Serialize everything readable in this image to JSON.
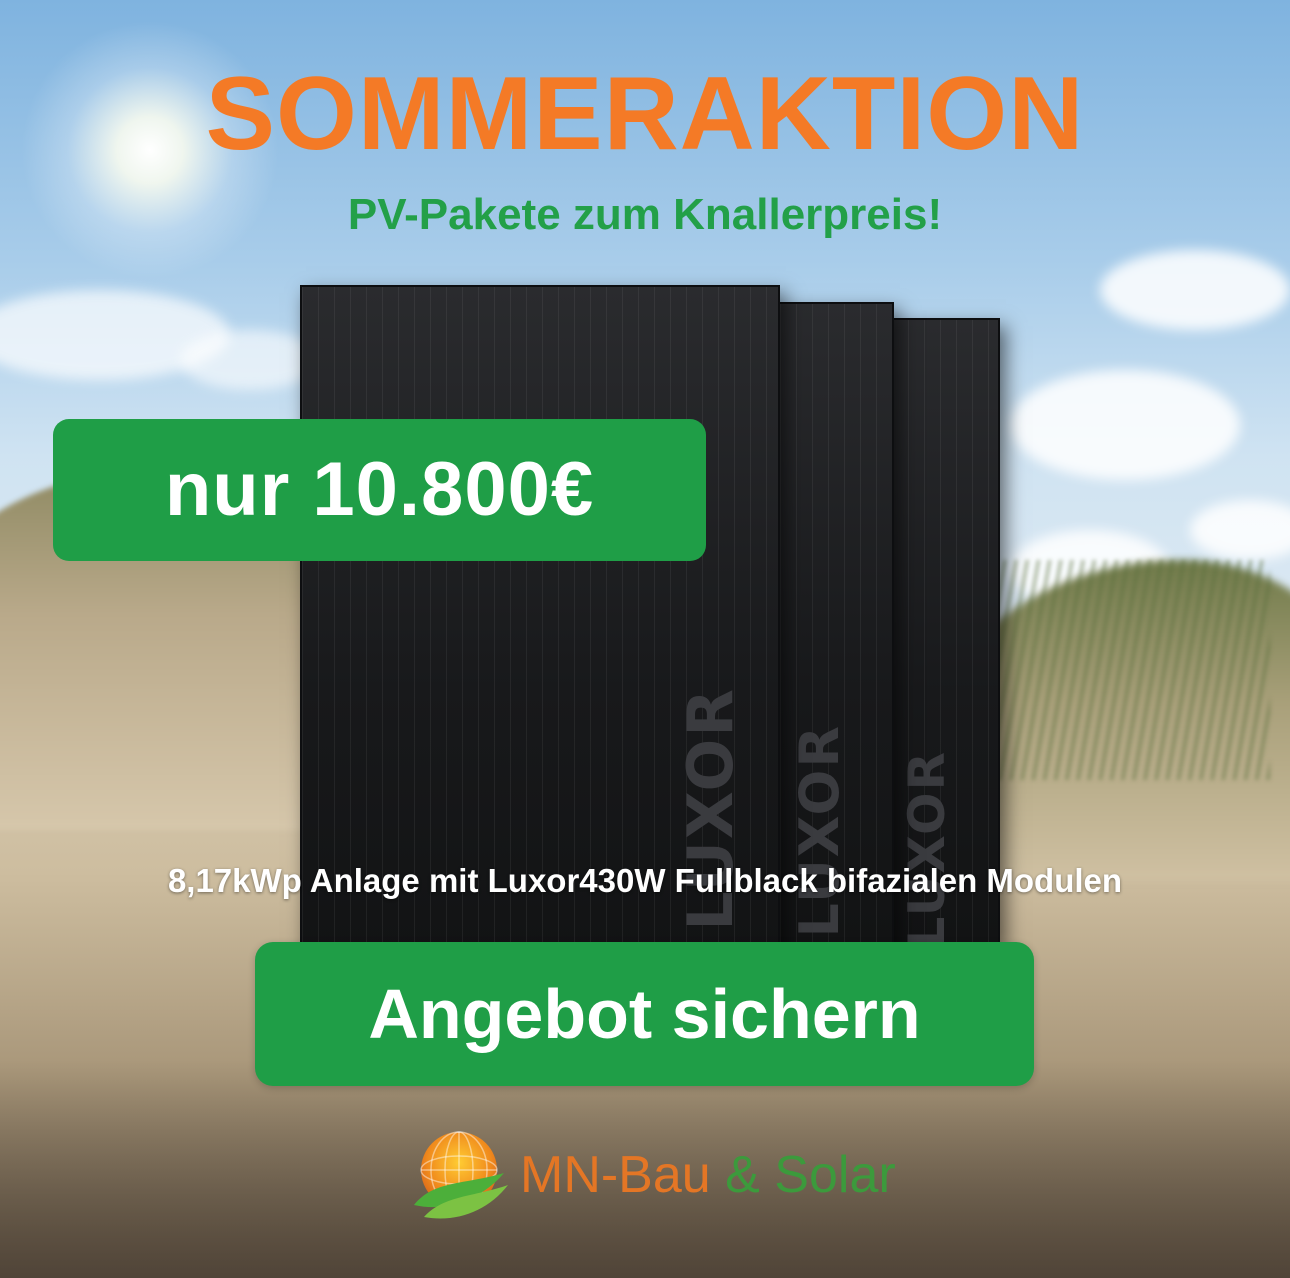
{
  "headline": "SOMMERAKTION",
  "subheadline": "PV-Pakete zum Knallerpreis!",
  "price_badge": "nur 10.800€",
  "description": "8,17kWp Anlage mit Luxor430W Fullblack bifazialen Modulen",
  "cta_label": "Angebot sichern",
  "panel_brand": "LUXOR",
  "logo": {
    "part1": "MN-Bau",
    "part2": "& Solar",
    "icon": "globe-sun-leaf-icon"
  },
  "colors": {
    "headline": "#f47a26",
    "subheadline": "#23a048",
    "badge_bg": "#1f9e47",
    "cta_bg": "#1f9e47",
    "text_light": "#ffffff"
  }
}
